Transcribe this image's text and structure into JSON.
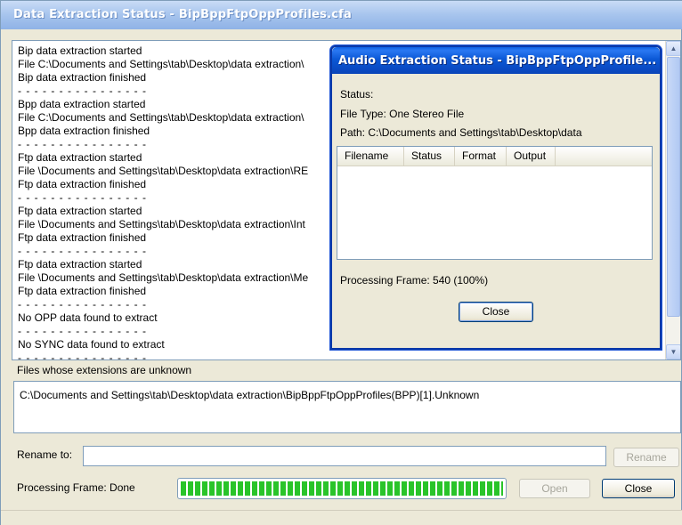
{
  "window": {
    "title": "Data Extraction Status - BipBppFtpOppProfiles.cfa"
  },
  "log": {
    "lines": [
      {
        "text": "Bip data extraction started",
        "kind": "text"
      },
      {
        "text": "File C:\\Documents and Settings\\tab\\Desktop\\data extraction\\",
        "kind": "text"
      },
      {
        "text": "Bip data extraction finished",
        "kind": "text"
      },
      {
        "text": "- - - - - - - - - - - - - - - -",
        "kind": "sep"
      },
      {
        "text": "Bpp data extraction started",
        "kind": "text"
      },
      {
        "text": "File C:\\Documents and Settings\\tab\\Desktop\\data extraction\\",
        "kind": "text"
      },
      {
        "text": "Bpp data extraction finished",
        "kind": "text"
      },
      {
        "text": "- - - - - - - - - - - - - - - -",
        "kind": "sep"
      },
      {
        "text": "Ftp data extraction started",
        "kind": "text"
      },
      {
        "text": "File \\Documents and Settings\\tab\\Desktop\\data extraction\\RE",
        "kind": "text"
      },
      {
        "text": "Ftp data extraction finished",
        "kind": "text"
      },
      {
        "text": "- - - - - - - - - - - - - - - -",
        "kind": "sep"
      },
      {
        "text": "Ftp data extraction started",
        "kind": "text"
      },
      {
        "text": "File \\Documents and Settings\\tab\\Desktop\\data extraction\\Int",
        "kind": "text"
      },
      {
        "text": "Ftp data extraction finished",
        "kind": "text"
      },
      {
        "text": "- - - - - - - - - - - - - - - -",
        "kind": "sep"
      },
      {
        "text": "Ftp data extraction started",
        "kind": "text"
      },
      {
        "text": "File \\Documents and Settings\\tab\\Desktop\\data extraction\\Me",
        "kind": "text"
      },
      {
        "text": "Ftp data extraction finished",
        "kind": "text"
      },
      {
        "text": "- - - - - - - - - - - - - - - -",
        "kind": "sep"
      },
      {
        "text": "No OPP data found to extract",
        "kind": "text"
      },
      {
        "text": "- - - - - - - - - - - - - - - -",
        "kind": "sep"
      },
      {
        "text": "No SYNC data found to extract",
        "kind": "text"
      },
      {
        "text": "- - - - - - - - - - - - - - - -",
        "kind": "sep"
      }
    ]
  },
  "unknown_files": {
    "label": "Files whose extensions are unknown",
    "items": [
      "C:\\Documents and Settings\\tab\\Desktop\\data extraction\\BipBppFtpOppProfiles(BPP)[1].Unknown"
    ]
  },
  "rename": {
    "label": "Rename to:",
    "value": "",
    "button": "Rename"
  },
  "footer": {
    "frame_label": "Processing Frame: Done",
    "progress": 1.0,
    "open_button": "Open",
    "close_button": "Close"
  },
  "dialog": {
    "title": "Audio Extraction Status - BipBppFtpOppProfile...",
    "status_label": "Status:",
    "file_type": "File Type: One Stereo File",
    "path": "Path: C:\\Documents and Settings\\tab\\Desktop\\data",
    "columns": [
      "Filename",
      "Status",
      "Format",
      "Output"
    ],
    "frame": "Processing Frame: 540 (100%)",
    "close_button": "Close"
  }
}
